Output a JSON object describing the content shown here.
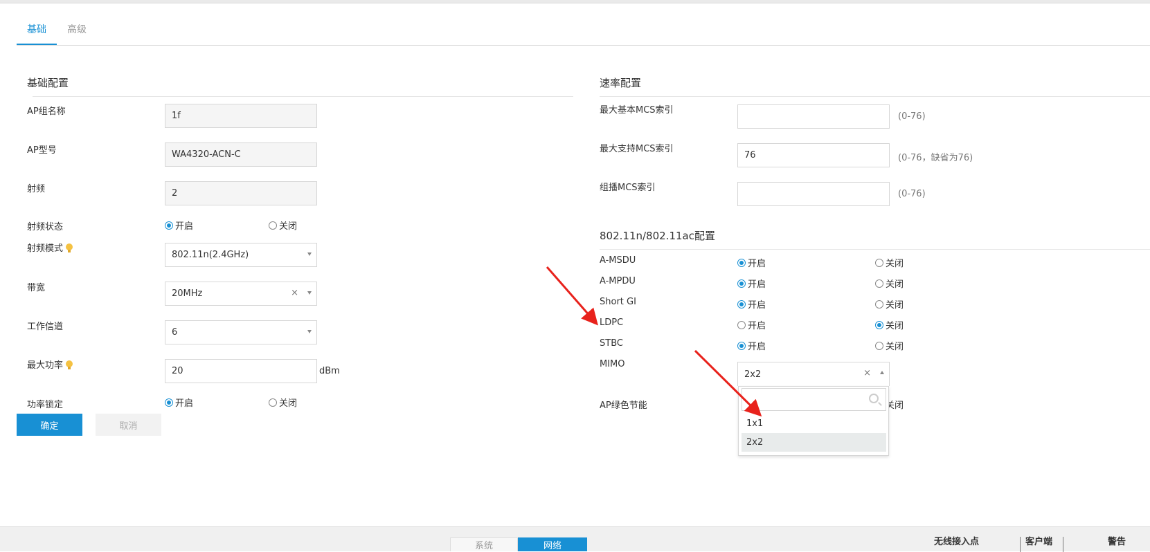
{
  "tabs": [
    {
      "label": "基础",
      "active": true
    },
    {
      "label": "高级",
      "active": false
    }
  ],
  "basic": {
    "title": "基础配置",
    "ap_group_name": {
      "label": "AP组名称",
      "value": "1f"
    },
    "ap_model": {
      "label": "AP型号",
      "value": "WA4320-ACN-C"
    },
    "radio": {
      "label": "射频",
      "value": "2"
    },
    "radio_status": {
      "label": "射频状态",
      "on": "开启",
      "off": "关闭",
      "selected": "on"
    },
    "radio_mode": {
      "label": "射频模式",
      "value": "802.11n(2.4GHz)"
    },
    "bandwidth": {
      "label": "带宽",
      "value": "20MHz",
      "clear": "×"
    },
    "channel": {
      "label": "工作信道",
      "value": "6"
    },
    "max_power": {
      "label": "最大功率",
      "value": "20",
      "unit": "dBm"
    },
    "power_lock": {
      "label": "功率锁定",
      "on": "开启",
      "off": "关闭",
      "selected": "on"
    }
  },
  "buttons": {
    "ok": "确定",
    "cancel": "取消"
  },
  "rate": {
    "title": "速率配置",
    "max_basic_mcs": {
      "label": "最大基本MCS索引",
      "value": "",
      "hint": "(0-76)"
    },
    "max_supported_mcs": {
      "label": "最大支持MCS索引",
      "value": "76",
      "hint": "(0-76，缺省为76)"
    },
    "multicast_mcs": {
      "label": "组播MCS索引",
      "value": "",
      "hint": "(0-76)"
    }
  },
  "n_ac": {
    "title": "802.11n/802.11ac配置",
    "rows": [
      {
        "label": "A-MSDU",
        "on": "开启",
        "off": "关闭",
        "selected": "on"
      },
      {
        "label": "A-MPDU",
        "on": "开启",
        "off": "关闭",
        "selected": "on"
      },
      {
        "label": "Short GI",
        "on": "开启",
        "off": "关闭",
        "selected": "on"
      },
      {
        "label": "LDPC",
        "on": "开启",
        "off": "关闭",
        "selected": "off"
      },
      {
        "label": "STBC",
        "on": "开启",
        "off": "关闭",
        "selected": "on"
      }
    ],
    "mimo": {
      "label": "MIMO",
      "value": "2x2",
      "clear": "×",
      "options": [
        "1x1",
        "2x2"
      ]
    },
    "ap_green": {
      "label": "AP绿色节能",
      "off": "关闭"
    }
  },
  "bottom": {
    "tabs": [
      {
        "label": "系统"
      },
      {
        "label": "网络"
      }
    ],
    "links": [
      {
        "label": "无线接入点"
      },
      {
        "label": "客户端"
      },
      {
        "label": "警告"
      }
    ]
  },
  "colors": {
    "accent": "#1890d4",
    "arrow": "#e8221c"
  }
}
